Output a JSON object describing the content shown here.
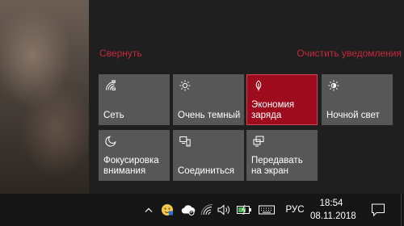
{
  "action_center": {
    "collapse_label": "Свернуть",
    "clear_label": "Очистить уведомления",
    "accent_color": "#c8283c",
    "tiles": [
      {
        "label": "Сеть",
        "icon": "network-icon",
        "active": false
      },
      {
        "label": "Очень темный",
        "icon": "brightness-icon",
        "active": false
      },
      {
        "label": "Экономия заряда",
        "icon": "battery-saver-icon",
        "active": true
      },
      {
        "label": "Ночной свет",
        "icon": "night-light-icon",
        "active": false
      },
      {
        "label": "Фокусировка внимания",
        "icon": "focus-assist-icon",
        "active": false
      },
      {
        "label": "Соединиться",
        "icon": "connect-icon",
        "active": false
      },
      {
        "label": "Передавать на экран",
        "icon": "project-icon",
        "active": false
      }
    ]
  },
  "taskbar": {
    "language": "РУС",
    "time": "18:54",
    "date": "08.11.2018",
    "tray_icons": [
      "chevron-up-icon",
      "emoji-app-icon",
      "cloud-sync-icon",
      "wifi-icon",
      "volume-icon",
      "battery-charging-icon",
      "keyboard-icon"
    ]
  }
}
